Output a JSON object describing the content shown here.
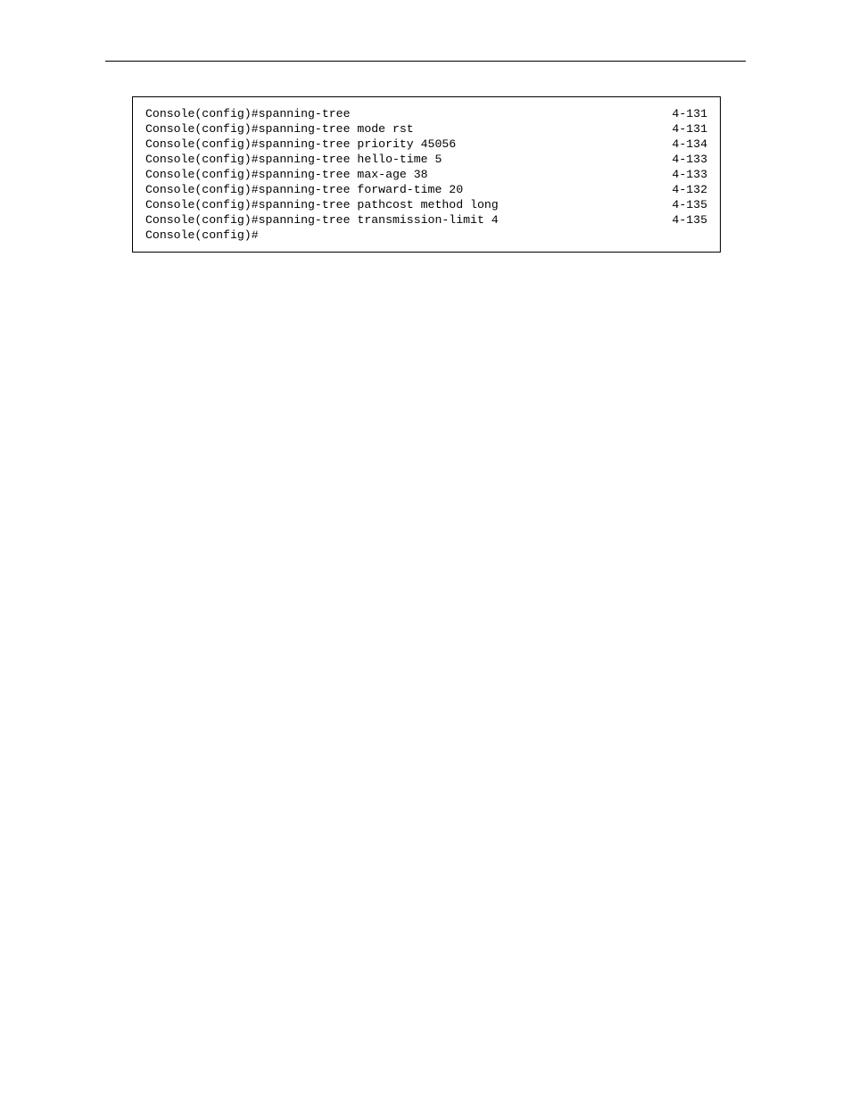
{
  "lines": [
    {
      "cmd": "Console(config)#spanning-tree",
      "ref": "4-131"
    },
    {
      "cmd": "Console(config)#spanning-tree mode rst",
      "ref": "4-131"
    },
    {
      "cmd": "Console(config)#spanning-tree priority 45056",
      "ref": "4-134"
    },
    {
      "cmd": "Console(config)#spanning-tree hello-time 5",
      "ref": "4-133"
    },
    {
      "cmd": "Console(config)#spanning-tree max-age 38",
      "ref": "4-133"
    },
    {
      "cmd": "Console(config)#spanning-tree forward-time 20",
      "ref": "4-132"
    },
    {
      "cmd": "Console(config)#spanning-tree pathcost method long",
      "ref": "4-135"
    },
    {
      "cmd": "Console(config)#spanning-tree transmission-limit 4",
      "ref": "4-135"
    },
    {
      "cmd": "Console(config)#",
      "ref": ""
    }
  ]
}
